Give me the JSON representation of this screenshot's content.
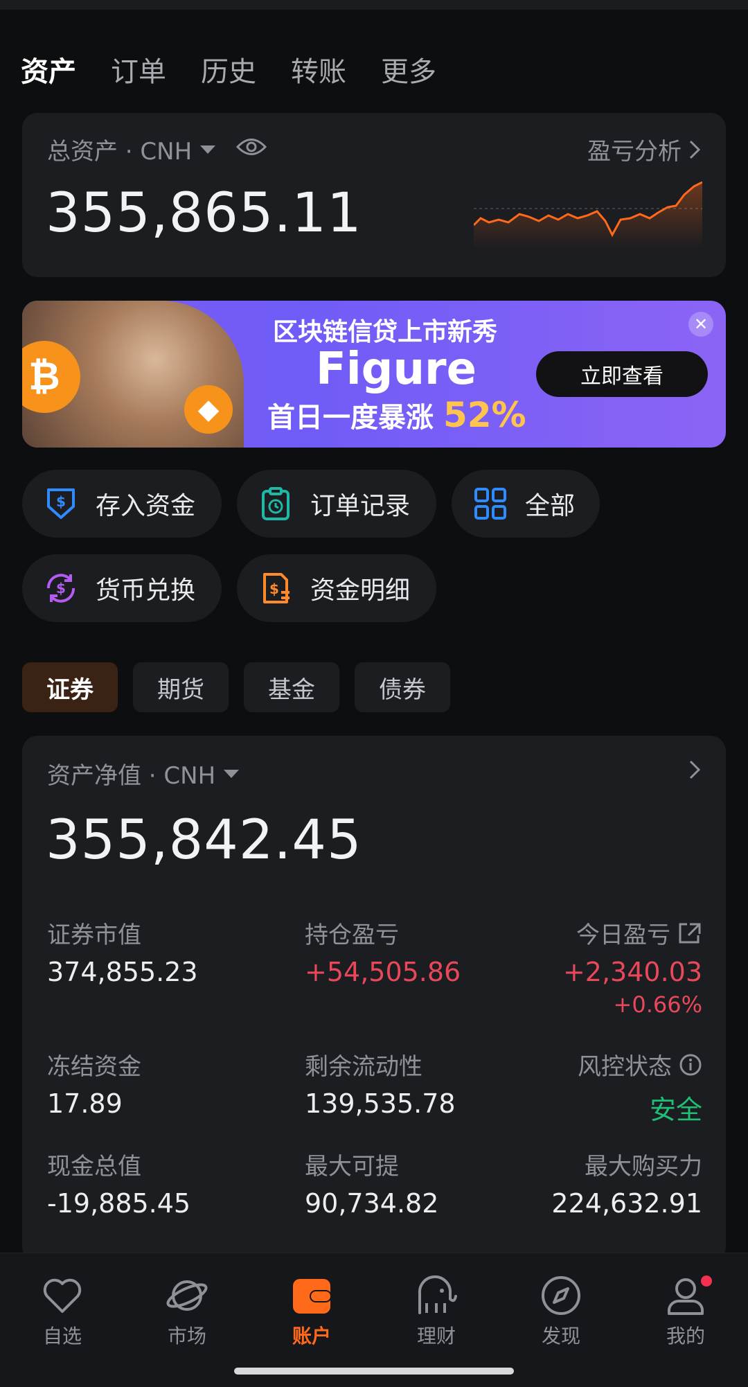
{
  "tabs": [
    "资产",
    "订单",
    "历史",
    "转账",
    "更多"
  ],
  "total": {
    "label": "总资产 · CNH",
    "pl_link": "盈亏分析",
    "value": "355,865.11"
  },
  "banner": {
    "line1": "区块链信贷上市新秀",
    "line2": "Figure",
    "line3_prefix": "首日一度暴涨 ",
    "line3_pct": "52%",
    "button": "立即查看",
    "close": "✕"
  },
  "actions": [
    {
      "label": "存入资金",
      "icon": "deposit-icon",
      "color": "#2f8cff"
    },
    {
      "label": "订单记录",
      "icon": "clipboard-clock-icon",
      "color": "#1fb8a6"
    },
    {
      "label": "全部",
      "icon": "grid-icon",
      "color": "#2f8cff"
    },
    {
      "label": "货币兑换",
      "icon": "currency-exchange-icon",
      "color": "#b25cf0"
    },
    {
      "label": "资金明细",
      "icon": "fund-detail-icon",
      "color": "#ff8a2b"
    }
  ],
  "segments": [
    "证券",
    "期货",
    "基金",
    "债券"
  ],
  "net": {
    "label": "资产净值 · CNH",
    "value": "355,842.45",
    "items": [
      {
        "k": "证券市值",
        "v": "374,855.23"
      },
      {
        "k": "持仓盈亏",
        "v": "+54,505.86"
      },
      {
        "k": "今日盈亏",
        "v": "+2,340.03",
        "sub": "+0.66%"
      },
      {
        "k": "冻结资金",
        "v": "17.89"
      },
      {
        "k": "剩余流动性",
        "v": "139,535.78"
      },
      {
        "k": "风控状态",
        "v": "安全"
      },
      {
        "k": "现金总值",
        "v": "-19,885.45"
      },
      {
        "k": "最大可提",
        "v": "90,734.82"
      },
      {
        "k": "最大购买力",
        "v": "224,632.91"
      }
    ]
  },
  "nav": [
    "自选",
    "市场",
    "账户",
    "理财",
    "发现",
    "我的"
  ],
  "colors": {
    "accent": "#ff6a1a",
    "up": "#e8485a",
    "safe": "#1fbf75"
  }
}
